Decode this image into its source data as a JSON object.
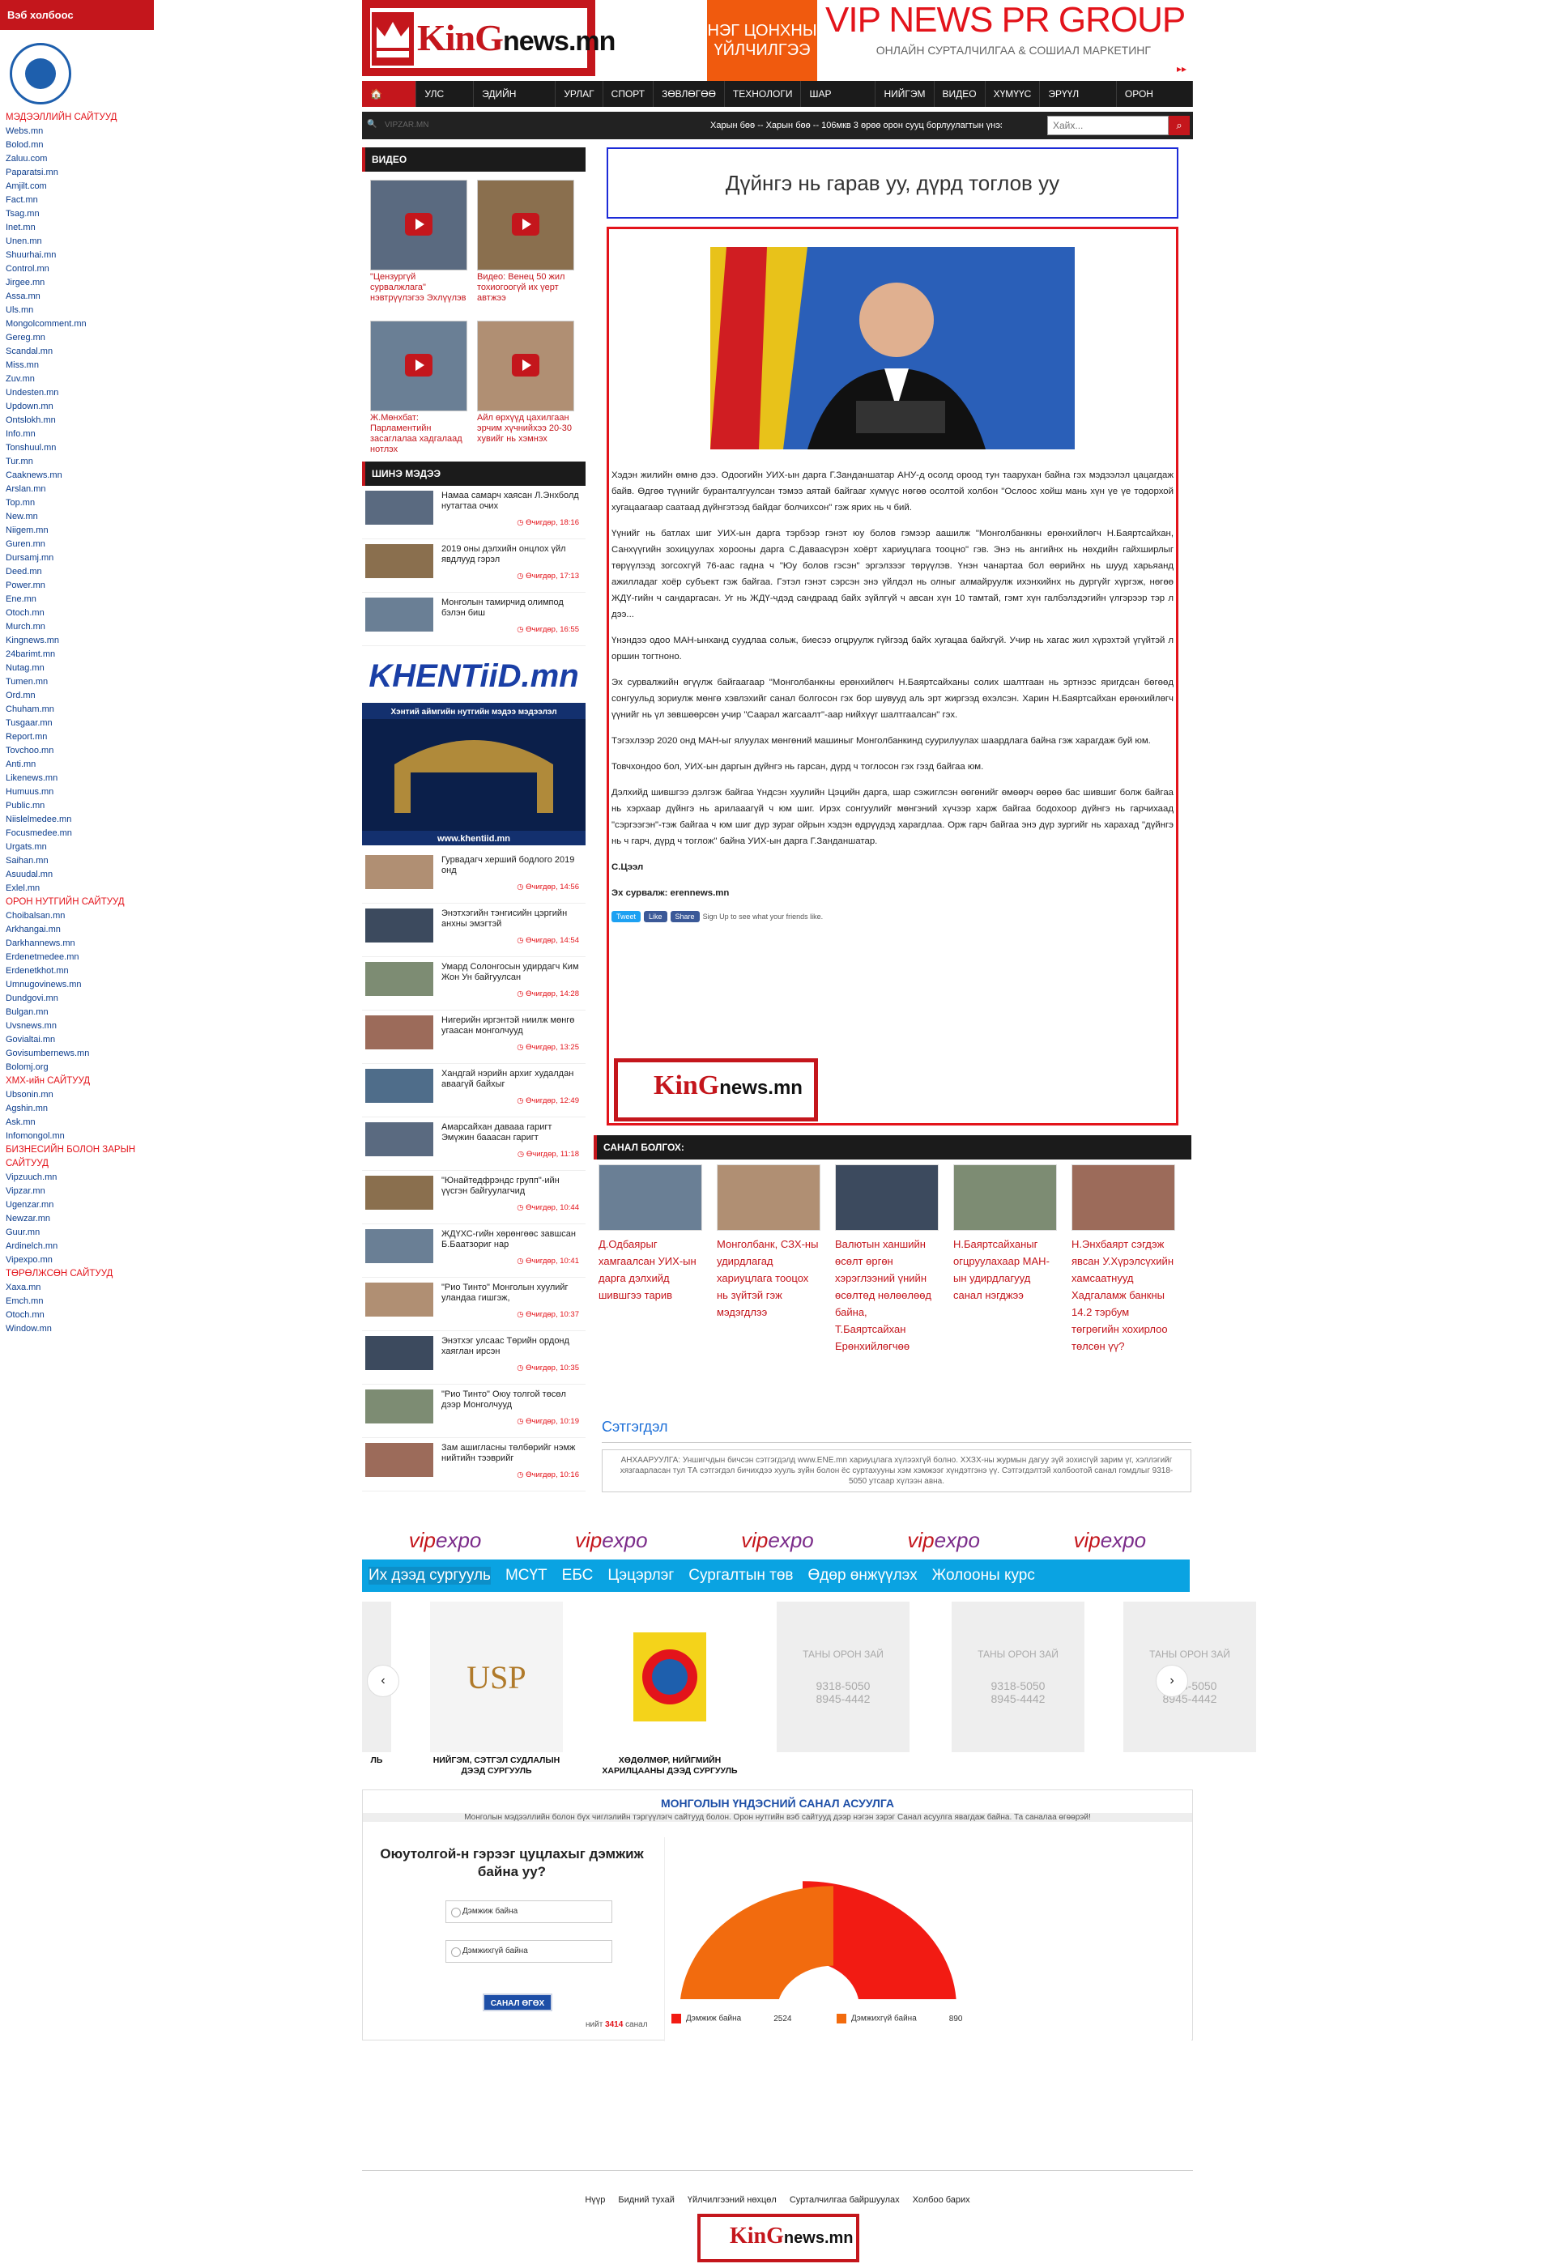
{
  "left_panel": {
    "header": "Вэб холбоос",
    "links": [
      [
        "s",
        "МЭДЭЭЛЛИЙН САЙТУУД"
      ],
      [
        "l",
        "Webs.mn"
      ],
      [
        "l",
        "Bolod.mn"
      ],
      [
        "l",
        "Zaluu.com"
      ],
      [
        "l",
        "Paparatsi.mn"
      ],
      [
        "l",
        "Amjilt.com"
      ],
      [
        "l",
        "Fact.mn"
      ],
      [
        "l",
        "Tsag.mn"
      ],
      [
        "l",
        "Inet.mn"
      ],
      [
        "l",
        "Unen.mn"
      ],
      [
        "l",
        "Shuurhai.mn"
      ],
      [
        "l",
        "Control.mn"
      ],
      [
        "l",
        "Jirgee.mn"
      ],
      [
        "l",
        "Assa.mn"
      ],
      [
        "l",
        "Uls.mn"
      ],
      [
        "l",
        "Mongolcomment.mn"
      ],
      [
        "l",
        "Gereg.mn"
      ],
      [
        "l",
        "Scandal.mn"
      ],
      [
        "l",
        "Miss.mn"
      ],
      [
        "l",
        "Zuv.mn"
      ],
      [
        "l",
        "Undesten.mn"
      ],
      [
        "l",
        "Updown.mn"
      ],
      [
        "l",
        "Ontslokh.mn"
      ],
      [
        "l",
        "Info.mn"
      ],
      [
        "l",
        "Tonshuul.mn"
      ],
      [
        "l",
        "Tur.mn"
      ],
      [
        "l",
        "Caaknews.mn"
      ],
      [
        "l",
        "Arslan.mn"
      ],
      [
        "l",
        "Top.mn"
      ],
      [
        "l",
        "New.mn"
      ],
      [
        "l",
        "Niigem.mn"
      ],
      [
        "l",
        "Guren.mn"
      ],
      [
        "l",
        "Dursamj.mn"
      ],
      [
        "l",
        "Deed.mn"
      ],
      [
        "l",
        "Power.mn"
      ],
      [
        "l",
        "Ene.mn"
      ],
      [
        "l",
        "Otoch.mn"
      ],
      [
        "l",
        "Murch.mn"
      ],
      [
        "l",
        "Kingnews.mn"
      ],
      [
        "l",
        "24barimt.mn"
      ],
      [
        "l",
        "Nutag.mn"
      ],
      [
        "l",
        "Tumen.mn"
      ],
      [
        "l",
        "Ord.mn"
      ],
      [
        "l",
        "Chuham.mn"
      ],
      [
        "l",
        "Tusgaar.mn"
      ],
      [
        "l",
        "Report.mn"
      ],
      [
        "l",
        "Tovchoo.mn"
      ],
      [
        "l",
        "Anti.mn"
      ],
      [
        "l",
        "Likenews.mn"
      ],
      [
        "l",
        "Humuus.mn"
      ],
      [
        "l",
        "Public.mn"
      ],
      [
        "l",
        "Niislelmedee.mn"
      ],
      [
        "l",
        "Focusmedee.mn"
      ],
      [
        "l",
        "Urgats.mn"
      ],
      [
        "l",
        "Saihan.mn"
      ],
      [
        "l",
        "Asuudal.mn"
      ],
      [
        "l",
        "Exlel.mn"
      ],
      [
        "s",
        "ОРОН НУТГИЙН САЙТУУД"
      ],
      [
        "l",
        "Choibalsan.mn"
      ],
      [
        "l",
        "Arkhangai.mn"
      ],
      [
        "l",
        "Darkhannews.mn"
      ],
      [
        "l",
        "Erdenetmedee.mn"
      ],
      [
        "l",
        "Erdenetkhot.mn"
      ],
      [
        "l",
        "Umnugovinews.mn"
      ],
      [
        "l",
        "Dundgovi.mn"
      ],
      [
        "l",
        "Bulgan.mn"
      ],
      [
        "l",
        "Uvsnews.mn"
      ],
      [
        "l",
        "Govialtai.mn"
      ],
      [
        "l",
        "Govisumbernews.mn"
      ],
      [
        "l",
        "Bolomj.org"
      ],
      [
        "s",
        "ХМХ-ийн САЙТУУД"
      ],
      [
        "l",
        "Ubsonin.mn"
      ],
      [
        "l",
        "Agshin.mn"
      ],
      [
        "l",
        "Ask.mn"
      ],
      [
        "l",
        "Infomongol.mn"
      ],
      [
        "s",
        "БИЗНЕСИЙН БОЛОН ЗАРЫН"
      ],
      [
        "s",
        "САЙТУУД"
      ],
      [
        "l",
        "Vipzuuch.mn"
      ],
      [
        "l",
        "Vipzar.mn"
      ],
      [
        "l",
        "Ugenzar.mn"
      ],
      [
        "l",
        "Newzar.mn"
      ],
      [
        "l",
        "Guur.mn"
      ],
      [
        "l",
        "Ardinelch.mn"
      ],
      [
        "l",
        "Vipexpo.mn"
      ],
      [
        "s",
        "ТӨРӨЛЖСӨН САЙТУУД"
      ],
      [
        "l",
        "Xaxa.mn"
      ],
      [
        "l",
        "Emch.mn"
      ],
      [
        "l",
        "Otoch.mn"
      ],
      [
        "l",
        "Window.mn"
      ]
    ]
  },
  "header": {
    "logo_main": "KinG",
    "logo_sub": "news.mn",
    "promo": "НЭГ ЦОНХНЫ ҮЙЛЧИЛГЭЭ",
    "vip_title": "VIP NEWS PR GROUP",
    "vip_sub": "ОНЛАЙН СУРТАЛЧИЛГАА & СОШИАЛ МАРКЕТИНГ",
    "vip_arrows": "▸▸"
  },
  "nav": [
    "НҮҮР",
    "УЛС ТӨР",
    "ЭДИЙН ЗАСАГ",
    "УРЛАГ",
    "СПОРТ",
    "ЗӨВЛӨГӨӨ",
    "ТЕХНОЛОГИ",
    "ШАР МЭДЭЭ",
    "НИЙГЭМ",
    "ВИДЕО",
    "ХҮМҮҮС",
    "ЭРҮҮЛ МЭНД",
    "ОРОН НУТАГ"
  ],
  "ticker": {
    "mail": "VIPZAR.MN",
    "news": "Харын бөө -- Харын бөө -- 106мкв 3 өрөө орон сууц борлуулагтын үнээ",
    "search_placeholder": "Хайх..."
  },
  "videos": {
    "header": "ВИДЕО",
    "items": [
      "\"Цензургүй сурвалжлага\" нэвтрүүлэгээ Эхлүүлэв",
      "Видео: Венец 50 жил тохиогоогүй их үерт автжээ",
      "Ж.Мөнхбат: Парламентийн засаглалаа хадгалаад нотлэх",
      "Айл өрхүүд цахилгаан эрчим хүчнийхээ 20-30 хувийг нь хэмнэх"
    ]
  },
  "news": {
    "header": "ШИНЭ МЭДЭЭ",
    "top": [
      [
        "Намаа самарч хаясан Л.Энхболд нутагтаа очих",
        "Өчигдөр, 18:16"
      ],
      [
        "2019 оны дэлхийн онцлох үйл явдлууд гэрэл",
        "Өчигдөр, 17:13"
      ],
      [
        "Монголын тамирчид олимпод бэлэн биш",
        "Өчигдөр, 16:55"
      ]
    ],
    "bottom": [
      [
        "Гурвадагч херший бодлого 2019 онд",
        "Өчигдөр, 14:56"
      ],
      [
        "Энэтхэгийн тэнгисийн цэргийн анхны эмэгтэй",
        "Өчигдөр, 14:54"
      ],
      [
        "Умард Солонгосын удирдагч Ким Жон Ун байгуулсан",
        "Өчигдөр, 14:28"
      ],
      [
        "Нигерийн иргэнтэй ниилж мөнгө угаасан монголчууд",
        "Өчигдөр, 13:25"
      ],
      [
        "Хандгай нэрийн архиг худалдан аваагүй байхыг",
        "Өчигдөр, 12:49"
      ],
      [
        "Амарсайхан давааа гаригт Эмүжин бааасан гаригт",
        "Өчигдөр, 11:18"
      ],
      [
        "\"Юнайтедфрэндс групп\"-ийн үүсгэн байгуулагчид",
        "Өчигдөр, 10:44"
      ],
      [
        "ЖДҮХС-гийн хөрөнгөөс завшсан Б.Баатзориг нар",
        "Өчигдөр, 10:41"
      ],
      [
        "\"Рио Тинто\" Монголын хуулийг уландаа гишгэж,",
        "Өчигдөр, 10:37"
      ],
      [
        "Энэтхэг улсаас Төрийн ордонд хаяглан ирсэн",
        "Өчигдөр, 10:35"
      ],
      [
        "\"Рио Тинто\" Оюу толгой төсөл дээр Монголчууд",
        "Өчигдөр, 10:19"
      ],
      [
        "Зам ашигласны төлбөрийг нэмж нийтийн тээврийг",
        "Өчигдөр, 10:16"
      ]
    ],
    "banner_title": "KHENTiiD.mn",
    "banner_sub": "Хэнтий аймгийн нутгийн мэдээ мэдээлэл",
    "banner_url": "www.khentiid.mn"
  },
  "article": {
    "title": "Дүйнгэ нь гарав уу, дүрд тоглов уу",
    "paras": [
      "Хэдэн жилийн өмнө дээ. Одоогийн УИХ-ын дарга Г.Занданшатар АНУ-д осолд ороод тун таарухан байна гэх мэдээлэл цацагдаж байв. Өдгөө түүнийг буранталгуулсан тэмээ аятай байгааг хүмүүс нөгөө осолтой холбон \"Ослоос хойш мань хүн үе үе тодорхой хугацаагаар саатаад дүйнгэтээд байдаг болчихсон\" гэж ярих нь ч бий.",
      "Үүнийг нь батлах шиг УИХ-ын дарга тэрбээр гэнэт юу болов гэмээр аашилж \"Монголбанкны ерөнхийлөгч Н.Баяртсайхан, Санхүүгийн зохицуулах хорооны дарга С.Даваасүрэн хоёрт хариуцлага тооцно\" гэв. Энэ нь ангийнх нь нөхдийн гайхширлыг төрүүлээд зогсохгүй 76-аас гадна ч \"Юу болов гэсэн\" эргэлзээг төрүүлэв. Үнэн чанартаа бол өөрийнх нь шууд харьяанд ажилладаг хоёр субъект гэж байгаа. Гэтэл гэнэт сэрсэн энэ үйлдэл нь олныг алмайруулж ихэнхийнх нь дургүйг хүргэж, нөгөө ЖДҮ-гийн ч сандаргасан. Уг нь ЖДҮ-чдэд сандраад байх зүйлгүй ч авсан хүн 10 тамтай, гэмт хүн галбэлздэгийн үлгэрээр тэр л дээ...",
      "Үнэндээ одоо МАН-ынханд суудлаа сольж, биесээ огцруулж гүйгээд байх хугацаа байхгүй. Учир нь хагас жил хүрэхтэй үгүйтэй л оршин тогтноно.",
      "Эх сурвалжийн өгүүлж байгаагаар \"Монголбанкны ерөнхийлөгч Н.Баяртсайханы солих шалтгаан нь эртнээс яригдсан бөгөөд сонгуульд зориулж мөнгө хэвлэхийг санал болгосон гэх бор шувууд аль эрт жиргээд өхэлсэн. Харин Н.Баяртсайхан ерөнхийлөгч үүнийг нь үл зөвшөөрсөн учир \"Саарал жагсаалт\"-аар нийхүүг шалтгаалсан\" гэх.",
      "Тэгэхлээр 2020 онд МАН-ыг ялуулах мөнгөний машиныг Монголбанкинд суурилуулах шаардлага байна гэж харагдаж буй юм.",
      "Товчхондоо бол, УИХ-ын даргын дүйнгэ нь гарсан, дүрд ч тоглосон гэх гэзд байгаа юм.",
      "Дэлхийд шившгээ дэлгэж байгаа Үндсэн хуулийн Цэцийн дарга, шар сэжиглсэн өөгөнийг өмөөрч өөрөө бас шившиг болж байгаа нь хэрхаар дүйнгэ нь арилааагүй ч юм шиг. Ирэх сонгуулийг мөнгэний хүчээр харж байгаа бодохоор дүйнгэ нь гарчихаад \"сэргээгэн\"-тэж байгаа ч юм шиг дүр зураг ойрын хэдэн өдрүүдэд харагдлаа. Орж гарч байгаа энэ дүр зургийг нь харахад \"дүйнгэ нь ч гарч, дүрд ч тоглож\" байна УИХ-ын дарга Г.Занданшатар."
    ],
    "author": "С.Цээл",
    "source": "Эх сурвалж: erennews.mn",
    "tweet": "Tweet",
    "like": "Like",
    "share": "Share",
    "signup": "Sign Up to see what your friends like."
  },
  "recommend": {
    "header": "САНАЛ БОЛГОХ:",
    "items": [
      "Д.Одбаярыг хамгаалсан УИХ-ын дарга дэлхийд шившгээ тарив",
      "Монголбанк, СЗХ-ны удирдлагад хариуцлага тооцох нь зүйтэй гэж мэдэгдлээ",
      "Валютын ханшийн өсөлт өргөн хэрэглээний үнийн өсөлтөд нөлөөлөөд байна, Т.Баяртсайхан Ерөнхийлөгчөө",
      "Н.Баяртсайханыг огцруулахаар МАН-ын удирдлагууд санал нэгджээ",
      "Н.Энхбаярт сэгдэж явсан У.Хүрэлсүхийн хамсаатнууд Хадгаламж банкны 14.2 тэрбум төгрөгийн хохирлоо төлсөн үү?"
    ]
  },
  "comments": {
    "title": "Сэтгэгдэл",
    "notice": "АНХААРУУЛГА: Уншигчдын бичсэн сэтгэгдэлд www.ENE.mn хариуцлага хүлээхгүй болно. ХХЗХ-ны журмын дагуу зүй зохисгүй зарим үг, хэллэгийг хязгаарласан тул ТА сэтгэгдэл бичихдээ хууль зүйн болон ёс суртахууны хэм хэмжээг хүндэтгэнэ үү. Сэтгэгдэлтэй холбоотой санал гомдлыг 9318-5050 утсаар хүлээн авна."
  },
  "vipexpo": [
    "vip",
    "expo"
  ],
  "edu": {
    "tabs": [
      "Их дээд сургууль",
      "МСҮТ",
      "ЕБС",
      "Цэцэрлэг",
      "Сургалтын төв",
      "Өдөр өнжүүлэх",
      "Жолооны курс"
    ],
    "cards": [
      [
        "НИЙГЭМ, СЭТГЭЛ СУДЛАЛЫН ДЭЭД СУРГУУЛЬ",
        "USP"
      ],
      [
        "ХӨДӨЛМӨР, НИЙГМИЙН ХАРИЛЦААНЫ ДЭЭД СУРГУУЛЬ",
        ""
      ],
      [
        "",
        "ТАНЫ ОРОН ЗАЙ"
      ],
      [
        "",
        "ТАНЫ ОРОН ЗАЙ"
      ],
      [
        "",
        "ТАНЫ ОРОН ЗАЙ"
      ]
    ],
    "phone1": "9318-5050",
    "phone2": "8945-4442",
    "left_stub": "ЛЬ"
  },
  "poll": {
    "title": "МОНГОЛЫН ҮНДЭСНИЙ САНАЛ АСУУЛГА",
    "sub": "Монголын мэдээллийн болон бүх чиглэлийн тэргүүлэгч сайтууд болон. Орон нутгийн вэб сайтууд дээр нэгэн зэрэг Санал асуулга явагдаж байна. Та саналаа өгөөрэй!",
    "question": "Оюутолгой-н гэрээг цуцлахыг дэмжиж байна уу?",
    "options": [
      "Дэмжиж байна",
      "Дэмжихгүй байна"
    ],
    "btn": "САНАЛ ӨГӨХ",
    "total_pre": "нийт",
    "total": "3414",
    "total_post": "санал",
    "colors": [
      "#f21b13",
      "#f26b0e"
    ]
  },
  "chart_data": {
    "type": "pie",
    "categories": [
      "Дэмжиж байна",
      "Дэмжихгүй байна"
    ],
    "values": [
      2524,
      890
    ]
  },
  "footer": [
    "Нүүр",
    "Бидний тухай",
    "Үйлчилгээний нөхцөл",
    "Сурталчилгаа байршуулах",
    "Холбоо барих"
  ]
}
